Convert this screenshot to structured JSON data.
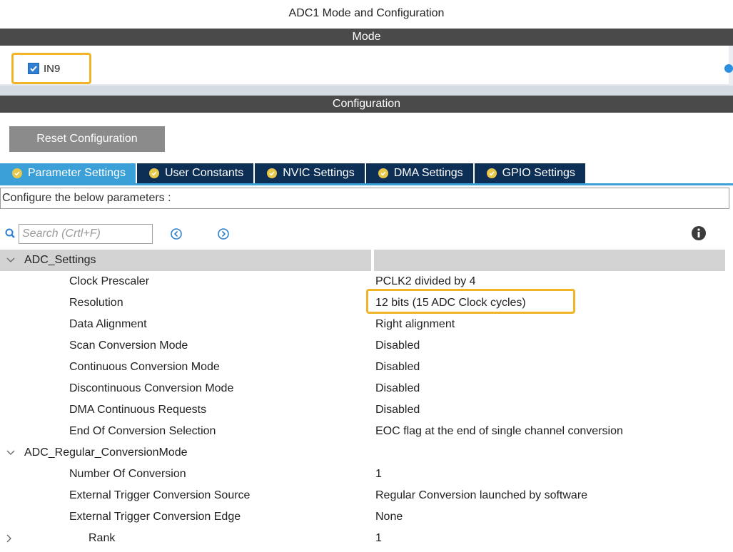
{
  "window": {
    "title": "ADC1 Mode and Configuration"
  },
  "mode": {
    "header": "Mode",
    "checkbox_label": "IN9",
    "checkbox_checked": true
  },
  "configuration": {
    "header": "Configuration",
    "reset_label": "Reset Configuration",
    "tabs": [
      {
        "label": "Parameter Settings",
        "active": true
      },
      {
        "label": "User Constants",
        "active": false
      },
      {
        "label": "NVIC Settings",
        "active": false
      },
      {
        "label": "DMA Settings",
        "active": false
      },
      {
        "label": "GPIO Settings",
        "active": false
      }
    ],
    "description": "Configure the below parameters :",
    "search_placeholder": "Search (Crtl+F)"
  },
  "tree": {
    "groups": [
      {
        "label": "ADC_Settings",
        "params": [
          {
            "name": "Clock Prescaler",
            "value": "PCLK2 divided by 4"
          },
          {
            "name": "Resolution",
            "value": "12 bits (15 ADC Clock cycles)"
          },
          {
            "name": "Data Alignment",
            "value": "Right alignment"
          },
          {
            "name": "Scan Conversion Mode",
            "value": "Disabled"
          },
          {
            "name": "Continuous Conversion Mode",
            "value": "Disabled"
          },
          {
            "name": "Discontinuous Conversion Mode",
            "value": "Disabled"
          },
          {
            "name": "DMA Continuous Requests",
            "value": "Disabled"
          },
          {
            "name": "End Of Conversion Selection",
            "value": "EOC flag at the end of single channel conversion"
          }
        ]
      },
      {
        "label": "ADC_Regular_ConversionMode",
        "params": [
          {
            "name": "Number Of Conversion",
            "value": "1"
          },
          {
            "name": "External Trigger Conversion Source",
            "value": "Regular Conversion launched by software"
          },
          {
            "name": "External Trigger Conversion Edge",
            "value": "None"
          },
          {
            "name": "Rank",
            "value": "1"
          }
        ]
      }
    ]
  },
  "colors": {
    "section_bar": "#4a4a4a",
    "tab_active": "#3ca0d8",
    "tab_inactive": "#0d2f56",
    "highlight": "#f0b428",
    "check_icon": "#e8c84a"
  },
  "icons": {
    "search": "search-icon",
    "prev": "circle-chevron-left-icon",
    "next": "circle-chevron-right-icon",
    "info": "info-icon",
    "expand": "chevron-down-icon",
    "collapse": "chevron-right-icon",
    "tab_check": "check-circle-icon"
  }
}
